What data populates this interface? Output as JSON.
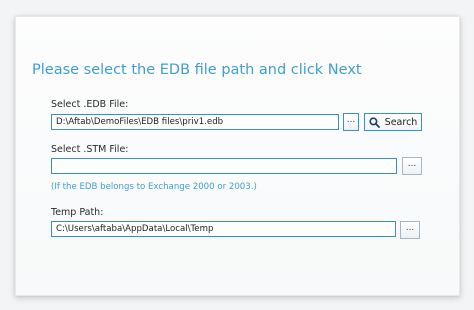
{
  "heading": "Please select the EDB file path and click Next",
  "edb": {
    "label": "Select .EDB File:",
    "value": "D:\\Aftab\\DemoFiles\\EDB files\\priv1.edb",
    "browse_label": "...",
    "search_label": "Search"
  },
  "stm": {
    "label": "Select .STM File:",
    "value": "",
    "browse_label": "...",
    "hint": "(If the EDB belongs to Exchange 2000 or 2003.)"
  },
  "temp": {
    "label": "Temp Path:",
    "value": "C:\\Users\\aftaba\\AppData\\Local\\Temp",
    "browse_label": "..."
  },
  "colors": {
    "accent": "#3f9fd0",
    "field_border": "#3a8fc8"
  },
  "icons": {
    "search": "search-icon"
  }
}
